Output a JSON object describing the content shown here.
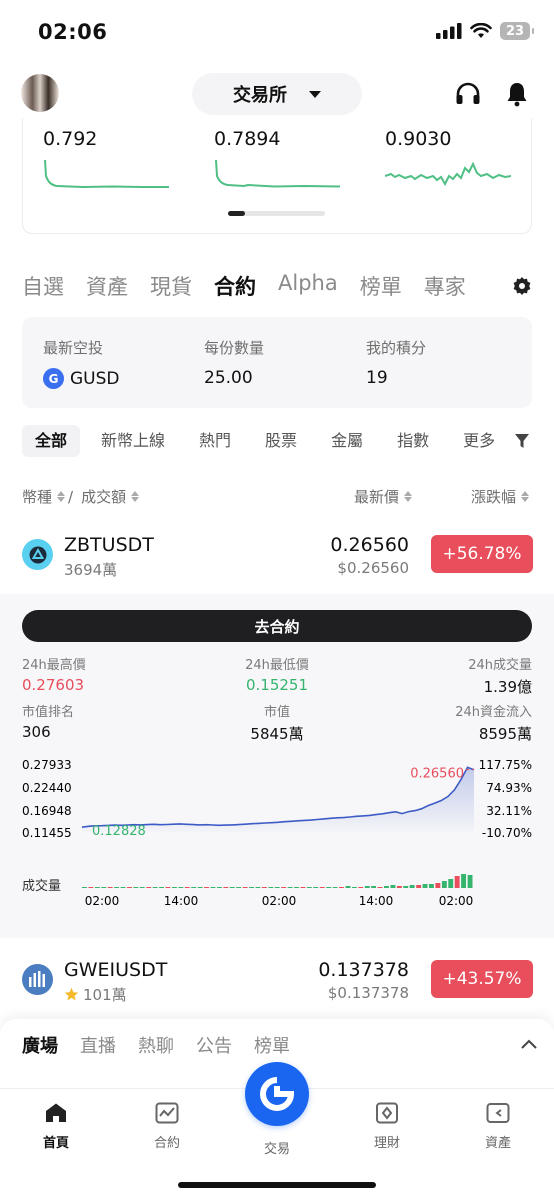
{
  "status_bar": {
    "time": "02:06",
    "battery": "23"
  },
  "header": {
    "title": "交易所"
  },
  "top_cards": [
    {
      "value": "0.792"
    },
    {
      "value": "0.7894"
    },
    {
      "value": "0.9030"
    }
  ],
  "main_tabs": [
    "自選",
    "資產",
    "現貨",
    "合約",
    "Alpha",
    "榜單",
    "專家"
  ],
  "main_tab_active": "合約",
  "airdrop": {
    "label1": "最新空投",
    "value1": "GUSD",
    "label2": "每份數量",
    "value2": "25.00",
    "label3": "我的積分",
    "value3": "19"
  },
  "sub_tabs": [
    "全部",
    "新幣上線",
    "熱門",
    "股票",
    "金屬",
    "指數",
    "更多"
  ],
  "list_header": {
    "coin": "幣種",
    "slash": "/",
    "volume": "成交額",
    "price": "最新價",
    "change": "漲跌幅"
  },
  "rows": [
    {
      "symbol": "ZBTUSDT",
      "volume": "3694萬",
      "price": "0.26560",
      "usd": "$0.26560",
      "change": "+56.78%"
    },
    {
      "symbol": "GWEIUSDT",
      "volume": "101萬",
      "price": "0.137378",
      "usd": "$0.137378",
      "change": "+43.57%"
    }
  ],
  "detail": {
    "go_button": "去合約",
    "high_label": "24h最高價",
    "high": "0.27603",
    "low_label": "24h最低價",
    "low": "0.15251",
    "vol_label": "24h成交量",
    "vol": "1.39億",
    "rank_label": "市值排名",
    "rank": "306",
    "mcap_label": "市值",
    "mcap": "5845萬",
    "flow_label": "24h資金流入",
    "flow": "8595萬",
    "volume_title": "成交量"
  },
  "chart_data": {
    "type": "line",
    "y_left_ticks": [
      "0.27933",
      "0.22440",
      "0.16948",
      "0.11455"
    ],
    "y_right_ticks": [
      "117.75%",
      "74.93%",
      "32.11%",
      "-10.70%"
    ],
    "x_ticks": [
      "02:00",
      "14:00",
      "02:00",
      "14:00",
      "02:00"
    ],
    "ylim": [
      0.11455,
      0.27933
    ],
    "low_label": "0.12828",
    "last_label": "0.26560",
    "series": [
      {
        "values": [
          0.1262,
          0.1283,
          0.1295,
          0.1298,
          0.1305,
          0.1312,
          0.1308,
          0.1315,
          0.1322,
          0.1318,
          0.1325,
          0.1331,
          0.1322,
          0.1328,
          0.1335,
          0.1341,
          0.1332,
          0.1324,
          0.1318,
          0.1322,
          0.1315,
          0.1308,
          0.1312,
          0.1318,
          0.1325,
          0.1335,
          0.1346,
          0.1355,
          0.1364,
          0.1372,
          0.1381,
          0.1394,
          0.1405,
          0.1418,
          0.1427,
          0.1435,
          0.1448,
          0.1462,
          0.1478,
          0.1489,
          0.1495,
          0.1508,
          0.1525,
          0.1536,
          0.1548,
          0.1566,
          0.1587,
          0.1612,
          0.1635,
          0.1592,
          0.164,
          0.1665,
          0.171,
          0.1788,
          0.1845,
          0.1908,
          0.2005,
          0.2165,
          0.2412,
          0.271,
          0.2656
        ]
      }
    ],
    "volume": [
      1,
      1,
      1,
      1,
      1,
      1,
      1,
      1,
      1,
      1,
      1,
      1,
      1,
      1,
      1,
      1,
      1,
      1,
      1,
      1,
      1,
      1,
      1,
      1,
      1,
      1,
      1,
      1,
      1,
      1,
      1,
      1,
      1,
      1,
      1,
      1,
      1,
      1,
      1,
      1,
      1,
      2,
      1,
      1,
      2,
      2,
      1,
      2,
      3,
      2,
      2,
      3,
      3,
      4,
      4,
      5,
      7,
      9,
      12,
      14,
      13
    ]
  },
  "feed_tabs": [
    "廣場",
    "直播",
    "熱聊",
    "公告",
    "榜單"
  ],
  "tab_bar": {
    "home": "首頁",
    "futures": "合約",
    "trade": "交易",
    "finance": "理財",
    "assets": "資產"
  },
  "colors": {
    "up": "#e84e5c",
    "green": "#35b46e",
    "brand": "#1a66f0",
    "line": "#3d5bc6"
  }
}
